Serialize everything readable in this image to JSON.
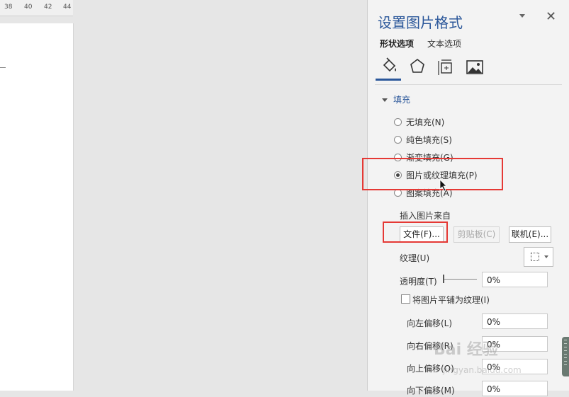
{
  "ruler": {
    "ticks": [
      "38",
      "40",
      "42",
      "44"
    ]
  },
  "panel": {
    "title": "设置图片格式",
    "tabs": {
      "shape": "形状选项",
      "text": "文本选项"
    },
    "section": "填充",
    "fill_options": [
      "无填充(N)",
      "纯色填充(S)",
      "渐变填充(G)",
      "图片或纹理填充(P)",
      "图案填充(A)"
    ],
    "selected_fill": "图片或纹理填充(P)",
    "insert_from_label": "插入图片来自",
    "buttons": {
      "file": "文件(F)...",
      "clipboard": "剪贴板(C)",
      "online": "联机(E)..."
    },
    "texture_label": "纹理(U)",
    "transparency_label": "透明度(T)",
    "transparency_value": "0%",
    "tile_label": "将图片平铺为纹理(I)",
    "offsets": [
      {
        "label": "向左偏移(L)",
        "value": "0%"
      },
      {
        "label": "向右偏移(R)",
        "value": "0%"
      },
      {
        "label": "向上偏移(O)",
        "value": "0%"
      },
      {
        "label": "向下偏移(M)",
        "value": "0%"
      }
    ]
  },
  "watermark": {
    "line1": "Bai 经验",
    "line2": "jingyan.baidu.com"
  },
  "colors": {
    "accent": "#2b579a",
    "highlight": "#e53935"
  }
}
